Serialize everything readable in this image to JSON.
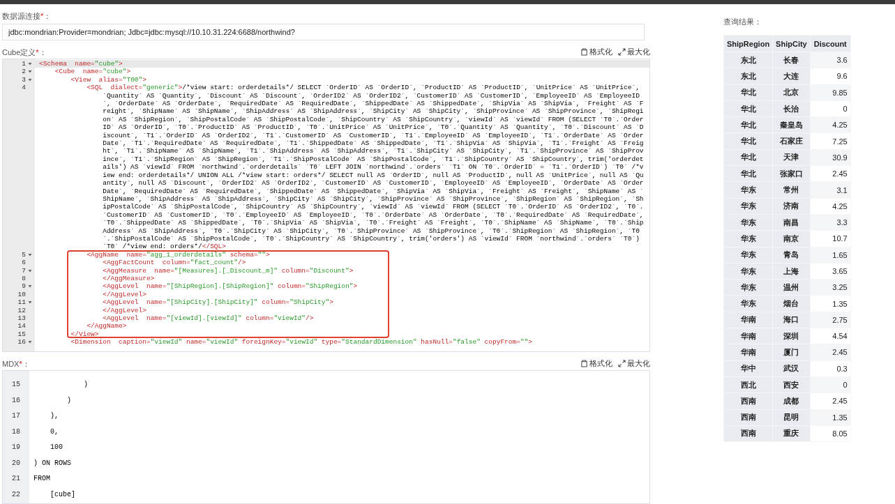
{
  "connection": {
    "label": "数据源连接",
    "required_mark": "*",
    "suffix": "：",
    "value": "jdbc:mondrian:Provider=mondrian; Jdbc=jdbc:mysql://10.10.31.224:6688/northwind?"
  },
  "cube_editor": {
    "label": "Cube定义",
    "required_mark": "*",
    "suffix": "：",
    "toolbar": [
      {
        "kind": "format",
        "label": "格式化"
      },
      {
        "kind": "maximize",
        "label": "最大化"
      }
    ],
    "lines": [
      {
        "number": "1",
        "foldable": true,
        "active": true,
        "highlighted": false,
        "code": "<Schema  name=\"cube\">"
      },
      {
        "number": "2",
        "foldable": true,
        "active": false,
        "highlighted": false,
        "code": "    <Cube  name=\"cube\">"
      },
      {
        "number": "3",
        "foldable": true,
        "active": false,
        "highlighted": false,
        "code": "        <View  alias=\"T00\">"
      },
      {
        "number": "4",
        "foldable": false,
        "active": false,
        "highlighted": false,
        "code": "            <SQL  dialect=\"generic\">/*view start: orderdetails*/ SELECT `OrderID` AS `OrderID`, `ProductID` AS `ProductID`, `UnitPrice` AS `UnitPrice`, `Quantity` AS `Quantity`, `Discount` AS `Discount`, `OrderID2` AS `OrderID2`, `CustomerID` AS `CustomerID`, `EmployeeID` AS `EmployeeID`, `OrderDate` AS `OrderDate`, `RequiredDate` AS `RequiredDate`, `ShippedDate` AS `ShippedDate`, `ShipVia` AS `ShipVia`, `Freight` AS `Freight`, `ShipName` AS `ShipName`, `ShipAddress` AS `ShipAddress`, `ShipCity` AS `ShipCity`, `ShipProvince` AS `ShipProvince`, `ShipRegion` AS `ShipRegion`, `ShipPostalCode` AS `ShipPostalCode`, `ShipCountry` AS `ShipCountry`, `viewId` AS `viewId` FROM (SELECT `T0`.`OrderID` AS `OrderID`, `T0`.`ProductID` AS `ProductID`, `T0`.`UnitPrice` AS `UnitPrice`, `T0`.`Quantity` AS `Quantity`, `T0`.`Discount` AS `Discount`, `T1`.`OrderID` AS `OrderID2`, `T1`.`CustomerID` AS `CustomerID`, `T1`.`EmployeeID` AS `EmployeeID`, `T1`.`OrderDate` AS `OrderDate`, `T1`.`RequiredDate` AS `RequiredDate`, `T1`.`ShippedDate` AS `ShippedDate`, `T1`.`ShipVia` AS `ShipVia`, `T1`.`Freight` AS `Freight`, `T1`.`ShipName` AS `ShipName`, `T1`.`ShipAddress` AS `ShipAddress`, `T1`.`ShipCity` AS `ShipCity`, `T1`.`ShipProvince` AS `ShipProvince`, `T1`.`ShipRegion` AS `ShipRegion`, `T1`.`ShipPostalCode` AS `ShipPostalCode`, `T1`.`ShipCountry` AS `ShipCountry`, trim('orderdetails') AS `viewId` FROM `northwind`.`orderdetails` `T0` LEFT JOIN `northwind`.`orders` `T1` ON `T0`.`OrderID` = `T1`.`OrderID`) `T0` /*view end: orderdetails*/ UNION ALL /*view start: orders*/ SELECT null AS `OrderID`, null AS `ProductID`, null AS `UnitPrice`, null AS `Quantity`, null AS `Discount`, `OrderID2` AS `OrderID2`, `CustomerID` AS `CustomerID`, `EmployeeID` AS `EmployeeID`, `OrderDate` AS `OrderDate`, `RequiredDate` AS `RequiredDate`, `ShippedDate` AS `ShippedDate`, `ShipVia` AS `ShipVia`, `Freight` AS `Freight`, `ShipName` AS `ShipName`, `ShipAddress` AS `ShipAddress`, `ShipCity` AS `ShipCity`, `ShipProvince` AS `ShipProvince`, `ShipRegion` AS `ShipRegion`, `ShipPostalCode` AS `ShipPostalCode`, `ShipCountry` AS `ShipCountry`, `viewId` AS `viewId` FROM (SELECT `T0`.`OrderID` AS `OrderID2`, `T0`.`CustomerID` AS `CustomerID`, `T0`.`EmployeeID` AS `EmployeeID`, `T0`.`OrderDate` AS `OrderDate`, `T0`.`RequiredDate` AS `RequiredDate`, `T0`.`ShippedDate` AS `ShippedDate`, `T0`.`ShipVia` AS `ShipVia`, `T0`.`Freight` AS `Freight`, `T0`.`ShipName` AS `ShipName`, `T0`.`ShipAddress` AS `ShipAddress`, `T0`.`ShipCity` AS `ShipCity`, `T0`.`ShipProvince` AS `ShipProvince`, `T0`.`ShipRegion` AS `ShipRegion`, `T0`.`ShipPostalCode` AS `ShipPostalCode`, `T0`.`ShipCountry` AS `ShipCountry`, trim('orders') AS `viewId` FROM `northwind`.`orders` `T0`) `T0` /*view end: orders*/</SQL>"
      },
      {
        "number": "5",
        "foldable": true,
        "active": false,
        "highlighted": true,
        "code": "            <AggName  name=\"agg_1_orderdetails\" schema=\"\">"
      },
      {
        "number": "6",
        "foldable": false,
        "active": false,
        "highlighted": true,
        "code": "                <AggFactCount  column=\"fact_count\"/>"
      },
      {
        "number": "7",
        "foldable": true,
        "active": false,
        "highlighted": true,
        "code": "                <AggMeasure  name=\"[Measures].[_Discount_m]\" column=\"Discount\">"
      },
      {
        "number": "8",
        "foldable": false,
        "active": false,
        "highlighted": true,
        "code": "                </AggMeasure>"
      },
      {
        "number": "9",
        "foldable": true,
        "active": false,
        "highlighted": true,
        "code": "                <AggLevel  name=\"[ShipRegion].[ShipRegion]\" column=\"ShipRegion\">"
      },
      {
        "number": "10",
        "foldable": false,
        "active": false,
        "highlighted": true,
        "code": "                </AggLevel>"
      },
      {
        "number": "11",
        "foldable": true,
        "active": false,
        "highlighted": true,
        "code": "                <AggLevel  name=\"[ShipCity].[ShipCity]\" column=\"ShipCity\">"
      },
      {
        "number": "12",
        "foldable": false,
        "active": false,
        "highlighted": true,
        "code": "                </AggLevel>"
      },
      {
        "number": "13",
        "foldable": false,
        "active": false,
        "highlighted": true,
        "code": "                <AggLevel  name=\"[viewId].[viewId]\" column=\"viewId\"/>"
      },
      {
        "number": "14",
        "foldable": false,
        "active": false,
        "highlighted": true,
        "code": "            </AggName>"
      },
      {
        "number": "15",
        "foldable": false,
        "active": false,
        "highlighted": true,
        "code": "        </View>"
      },
      {
        "number": "16",
        "foldable": true,
        "active": false,
        "highlighted": false,
        "code": "        <Dimension  caption=\"viewId\" name=\"viewId\" foreignKey=\"viewId\" type=\"StandardDimension\" hasNull=\"false\" copyFrom=\"\">"
      }
    ]
  },
  "mdx_editor": {
    "label": "MDX",
    "required_mark": "*",
    "suffix": "：",
    "toolbar": [
      {
        "kind": "format",
        "label": "格式化"
      },
      {
        "kind": "maximize",
        "label": "最大化"
      }
    ],
    "lines": [
      {
        "number": "15",
        "code": "            )"
      },
      {
        "number": "16",
        "code": "        )"
      },
      {
        "number": "17",
        "code": "    ),"
      },
      {
        "number": "18",
        "code": "    0,"
      },
      {
        "number": "19",
        "code": "    100"
      },
      {
        "number": "20",
        "code": ") ON ROWS"
      },
      {
        "number": "21",
        "code": "FROM"
      },
      {
        "number": "22",
        "code": "    [cube]"
      }
    ]
  },
  "results": {
    "title": "查询结果：",
    "columns": [
      "ShipRegion",
      "ShipCity",
      "Discount"
    ],
    "rows": [
      [
        "东北",
        "长春",
        "3.6"
      ],
      [
        "东北",
        "大连",
        "9.6"
      ],
      [
        "华北",
        "北京",
        "9.85"
      ],
      [
        "华北",
        "长治",
        "0"
      ],
      [
        "华北",
        "秦皇岛",
        "4.25"
      ],
      [
        "华北",
        "石家庄",
        "7.25"
      ],
      [
        "华北",
        "天津",
        "30.9"
      ],
      [
        "华北",
        "张家口",
        "2.45"
      ],
      [
        "华东",
        "常州",
        "3.1"
      ],
      [
        "华东",
        "济南",
        "4.25"
      ],
      [
        "华东",
        "南昌",
        "3.3"
      ],
      [
        "华东",
        "南京",
        "10.7"
      ],
      [
        "华东",
        "青岛",
        "1.65"
      ],
      [
        "华东",
        "上海",
        "3.65"
      ],
      [
        "华东",
        "温州",
        "3.25"
      ],
      [
        "华东",
        "烟台",
        "1.35"
      ],
      [
        "华南",
        "海口",
        "2.75"
      ],
      [
        "华南",
        "深圳",
        "4.54"
      ],
      [
        "华南",
        "厦门",
        "2.45"
      ],
      [
        "华中",
        "武汉",
        "0.3"
      ],
      [
        "西北",
        "西安",
        "0"
      ],
      [
        "西南",
        "成都",
        "2.45"
      ],
      [
        "西南",
        "昆明",
        "1.35"
      ],
      [
        "西南",
        "重庆",
        "8.05"
      ]
    ]
  }
}
